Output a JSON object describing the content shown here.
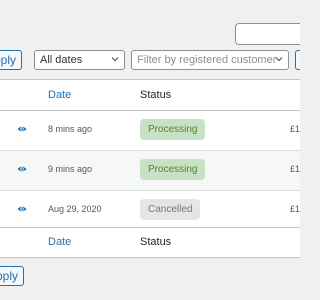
{
  "toolbar": {
    "apply_label": "pply",
    "date_filter": "All dates",
    "customer_placeholder": "Filter by registered customer"
  },
  "table": {
    "headers": {
      "date": "Date",
      "status": "Status"
    },
    "rows": [
      {
        "date": "8 mins ago",
        "status": "Processing",
        "status_kind": "processing",
        "total": "£1"
      },
      {
        "date": "9 mins ago",
        "status": "Processing",
        "status_kind": "processing",
        "total": "£1"
      },
      {
        "date": "Aug 29, 2020",
        "status": "Cancelled",
        "status_kind": "cancelled",
        "total": "£1"
      }
    ]
  },
  "bottom_toolbar": {
    "apply_label": "pply"
  },
  "colors": {
    "link": "#2271b1",
    "processing_bg": "#c6e1c6",
    "processing_text": "#5b841b",
    "cancelled_bg": "#e5e5e5",
    "cancelled_text": "#777777"
  }
}
